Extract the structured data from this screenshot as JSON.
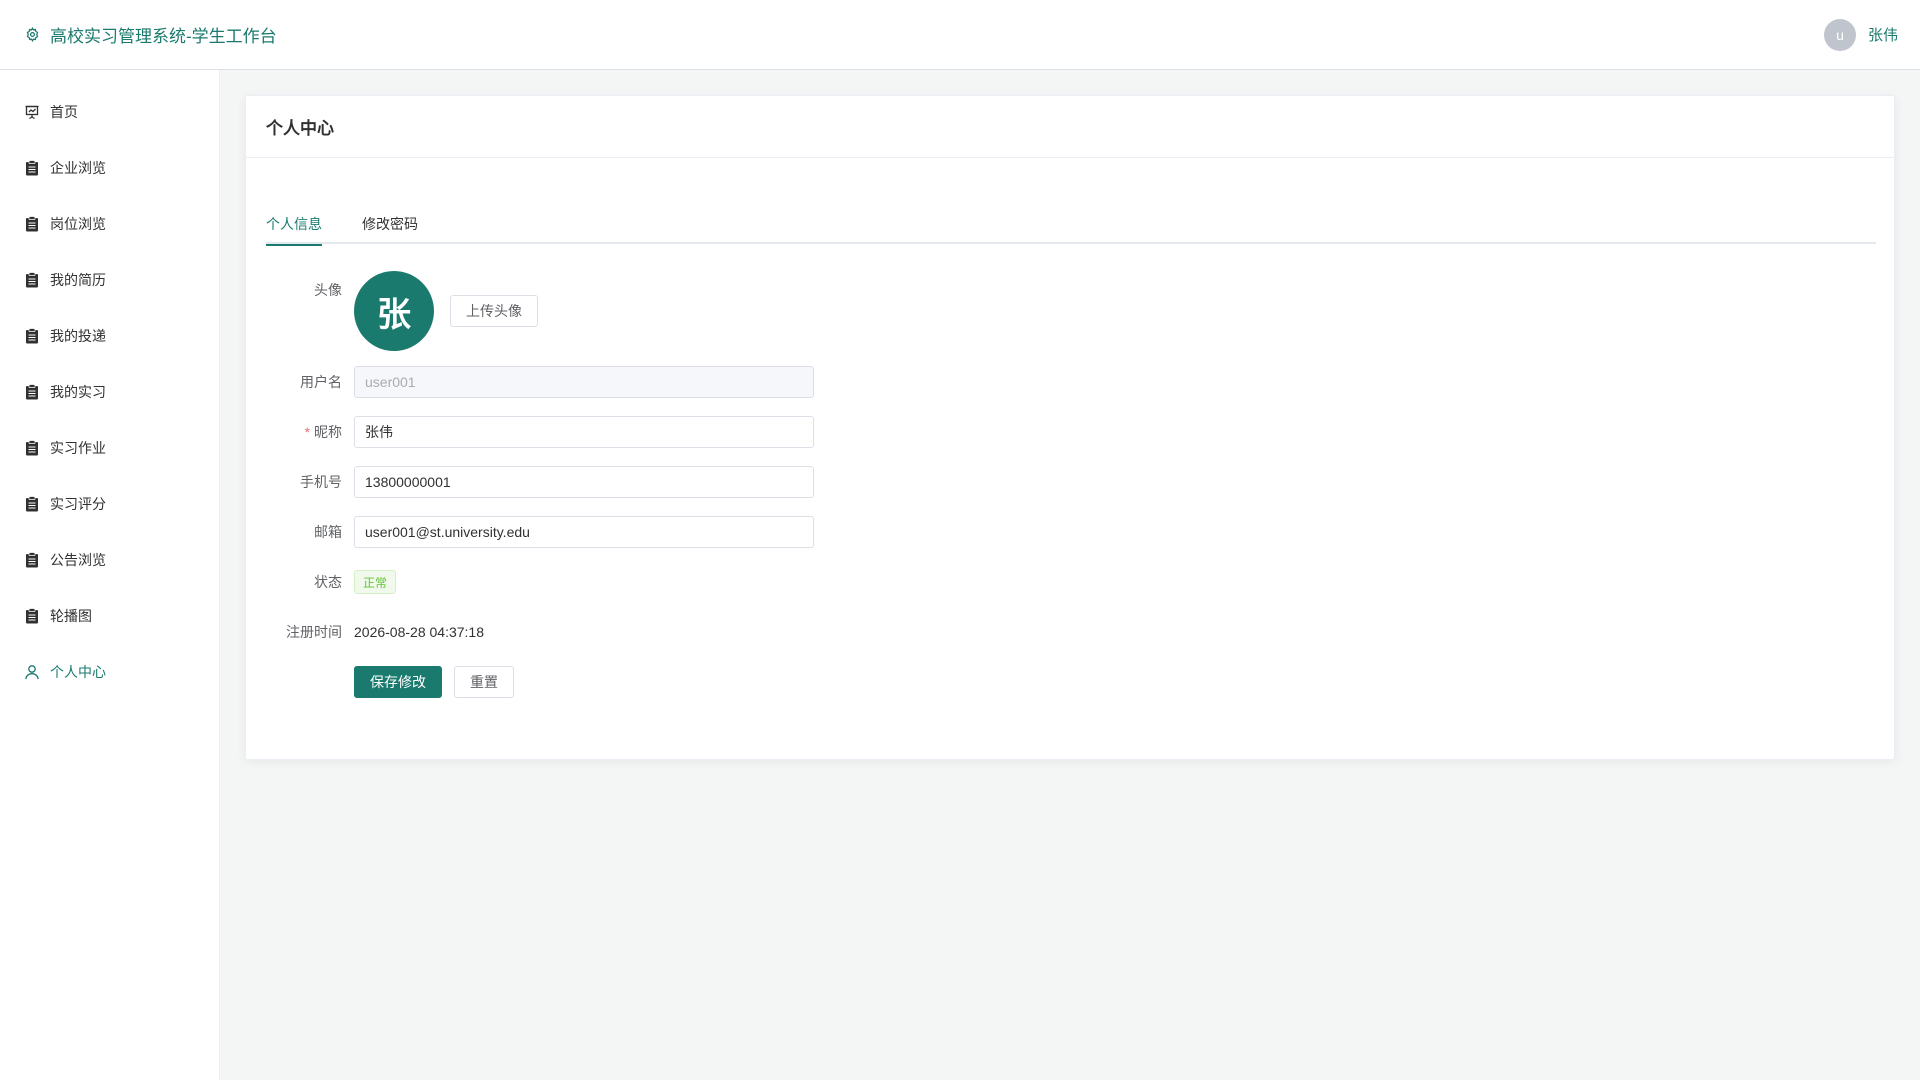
{
  "header": {
    "title": "高校实习管理系统-学生工作台",
    "avatar_letter": "u",
    "user_name": "张伟",
    "accent_color": "#1a7a6e"
  },
  "sidebar": {
    "items": [
      {
        "label": "首页",
        "icon": "presentation-icon"
      },
      {
        "label": "企业浏览",
        "icon": "clipboard-icon"
      },
      {
        "label": "岗位浏览",
        "icon": "clipboard-icon"
      },
      {
        "label": "我的简历",
        "icon": "clipboard-icon"
      },
      {
        "label": "我的投递",
        "icon": "clipboard-icon"
      },
      {
        "label": "我的实习",
        "icon": "clipboard-icon"
      },
      {
        "label": "实习作业",
        "icon": "clipboard-icon"
      },
      {
        "label": "实习评分",
        "icon": "clipboard-icon"
      },
      {
        "label": "公告浏览",
        "icon": "clipboard-icon"
      },
      {
        "label": "轮播图",
        "icon": "clipboard-icon"
      },
      {
        "label": "个人中心",
        "icon": "user-icon"
      }
    ],
    "active_item": "个人中心"
  },
  "card": {
    "title": "个人中心",
    "tabs": [
      {
        "label": "个人信息"
      },
      {
        "label": "修改密码"
      }
    ]
  },
  "form": {
    "avatar": {
      "label": "头像",
      "letter": "张",
      "upload_label": "上传头像"
    },
    "username": {
      "label": "用户名",
      "value": "user001"
    },
    "nickname": {
      "label": "昵称",
      "required_mark": "*",
      "value": "张伟"
    },
    "phone": {
      "label": "手机号",
      "value": "13800000001"
    },
    "email": {
      "label": "邮箱",
      "value": "user001@st.university.edu"
    },
    "status": {
      "label": "状态",
      "value": "正常"
    },
    "register_time": {
      "label": "注册时间",
      "value": "2026-08-28 04:37:18"
    },
    "save_label": "保存修改",
    "reset_label": "重置"
  }
}
